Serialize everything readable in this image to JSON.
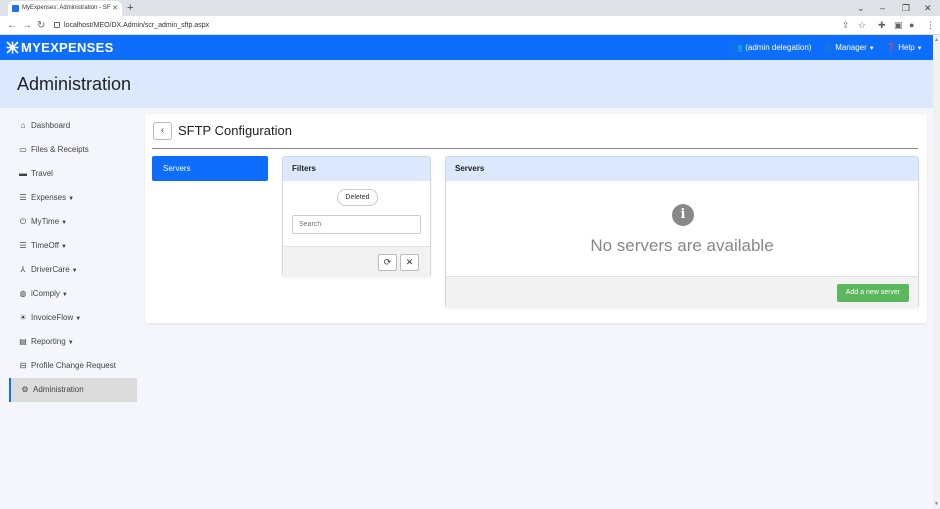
{
  "browser": {
    "tab_title": "MyExpenses: Administration - SF",
    "url": "localhost/MEO/DX.Admin/scr_admin_sftp.aspx"
  },
  "header": {
    "logo_text": "MYEXPENSES",
    "delegation": "(admin delegation)",
    "manager": "Manager",
    "help": "Help"
  },
  "page": {
    "title": "Administration"
  },
  "sidebar": {
    "items": [
      {
        "label": "Dashboard",
        "icon": "home-icon",
        "dropdown": false
      },
      {
        "label": "Files & Receipts",
        "icon": "image-icon",
        "dropdown": false
      },
      {
        "label": "Travel",
        "icon": "suitcase-icon",
        "dropdown": false
      },
      {
        "label": "Expenses",
        "icon": "list-icon",
        "dropdown": true
      },
      {
        "label": "MyTime",
        "icon": "clock-icon",
        "dropdown": true
      },
      {
        "label": "TimeOff",
        "icon": "calendar-icon",
        "dropdown": true
      },
      {
        "label": "DriverCare",
        "icon": "road-icon",
        "dropdown": true
      },
      {
        "label": "iComply",
        "icon": "globe-icon",
        "dropdown": true
      },
      {
        "label": "InvoiceFlow",
        "icon": "sun-icon",
        "dropdown": true
      },
      {
        "label": "Reporting",
        "icon": "chart-icon",
        "dropdown": true
      },
      {
        "label": "Profile Change Request",
        "icon": "inbox-icon",
        "dropdown": false
      },
      {
        "label": "Administration",
        "icon": "gears-icon",
        "dropdown": false,
        "active": true
      }
    ]
  },
  "main": {
    "section_title": "SFTP Configuration",
    "servers_tab": "Servers",
    "filters": {
      "title": "Filters",
      "deleted_label": "Deleted",
      "search_placeholder": "Search"
    },
    "servers": {
      "title": "Servers",
      "empty_message": "No servers are available",
      "add_button": "Add a new server"
    }
  },
  "colors": {
    "brand_blue": "#0d6efd",
    "title_band": "#dbe8fe",
    "add_green": "#5cb85c"
  }
}
